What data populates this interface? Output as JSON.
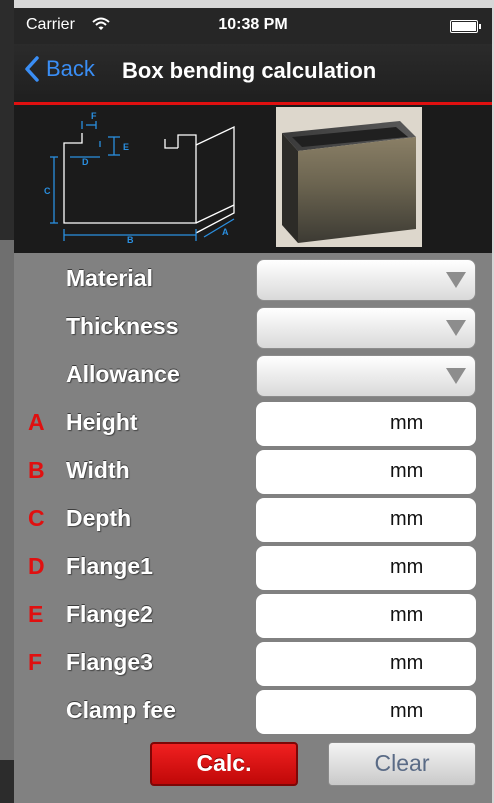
{
  "status": {
    "carrier": "Carrier",
    "time": "10:38 PM"
  },
  "nav": {
    "back_label": "Back",
    "title": "Box bending calculation"
  },
  "diagram": {
    "labels": [
      "F",
      "E",
      "D",
      "C",
      "B",
      "A"
    ]
  },
  "colors": {
    "accent_red": "#e01010",
    "link_blue": "#3a8ef5",
    "diagram_blue": "#2a8fe0"
  },
  "fields": [
    {
      "letter": "",
      "label": "Material",
      "type": "select"
    },
    {
      "letter": "",
      "label": "Thickness",
      "type": "select"
    },
    {
      "letter": "",
      "label": "Allowance",
      "type": "select"
    },
    {
      "letter": "A",
      "label": "Height",
      "type": "input",
      "unit": "mm"
    },
    {
      "letter": "B",
      "label": "Width",
      "type": "input",
      "unit": "mm"
    },
    {
      "letter": "C",
      "label": "Depth",
      "type": "input",
      "unit": "mm"
    },
    {
      "letter": "D",
      "label": "Flange1",
      "type": "input",
      "unit": "mm"
    },
    {
      "letter": "E",
      "label": "Flange2",
      "type": "input",
      "unit": "mm"
    },
    {
      "letter": "F",
      "label": "Flange3",
      "type": "input",
      "unit": "mm"
    },
    {
      "letter": "",
      "label": "Clamp fee",
      "type": "input",
      "unit": "mm"
    }
  ],
  "buttons": {
    "calc": "Calc.",
    "clear": "Clear"
  }
}
